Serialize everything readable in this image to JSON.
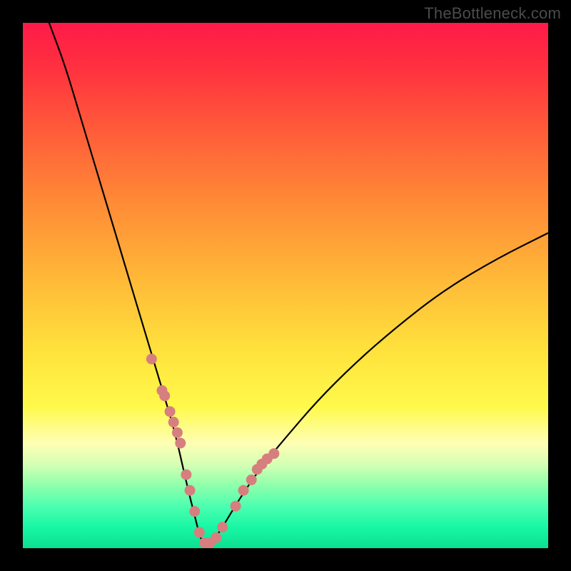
{
  "watermark": "TheBottleneck.com",
  "colors": {
    "background": "#000000",
    "curve": "#000000",
    "dot_fill": "#d67f7e",
    "dot_stroke": "#d67f7e",
    "gradient_top": "#ff1a49",
    "gradient_bottom": "#0be090"
  },
  "chart_data": {
    "type": "line",
    "title": "",
    "xlabel": "",
    "ylabel": "",
    "x_range": [
      0,
      100
    ],
    "y_range_percent": [
      0,
      100
    ],
    "note": "V-shaped bottleneck curve; minimum (≈0%) reached near x≈34; rises steeply to ≈100% as x→0 and to ≈60% as x→100. Data points overlay the curve primarily in the 24–48 x-range.",
    "series": [
      {
        "name": "bottleneck_curve",
        "x": [
          5,
          8,
          11,
          14,
          17,
          20,
          23,
          26,
          29,
          31,
          33,
          34,
          36,
          38,
          41,
          45,
          50,
          56,
          63,
          71,
          80,
          90,
          100
        ],
        "y": [
          100,
          92,
          82,
          72,
          62,
          52,
          42,
          32,
          22,
          13,
          5,
          1,
          1,
          4,
          9,
          15,
          21,
          28,
          35,
          42,
          49,
          55,
          60
        ]
      },
      {
        "name": "data_points",
        "x": [
          24.5,
          26.5,
          27.0,
          28.0,
          28.7,
          29.4,
          30.0,
          31.1,
          31.8,
          32.7,
          33.6,
          34.6,
          35.6,
          36.8,
          38.0,
          40.5,
          42.0,
          43.5,
          44.6,
          45.5,
          46.5,
          47.8
        ],
        "y": [
          36,
          30,
          29,
          26,
          24,
          22,
          20,
          14,
          11,
          7,
          3,
          1,
          1,
          2,
          4,
          8,
          11,
          13,
          15,
          16,
          17,
          18
        ]
      }
    ]
  }
}
